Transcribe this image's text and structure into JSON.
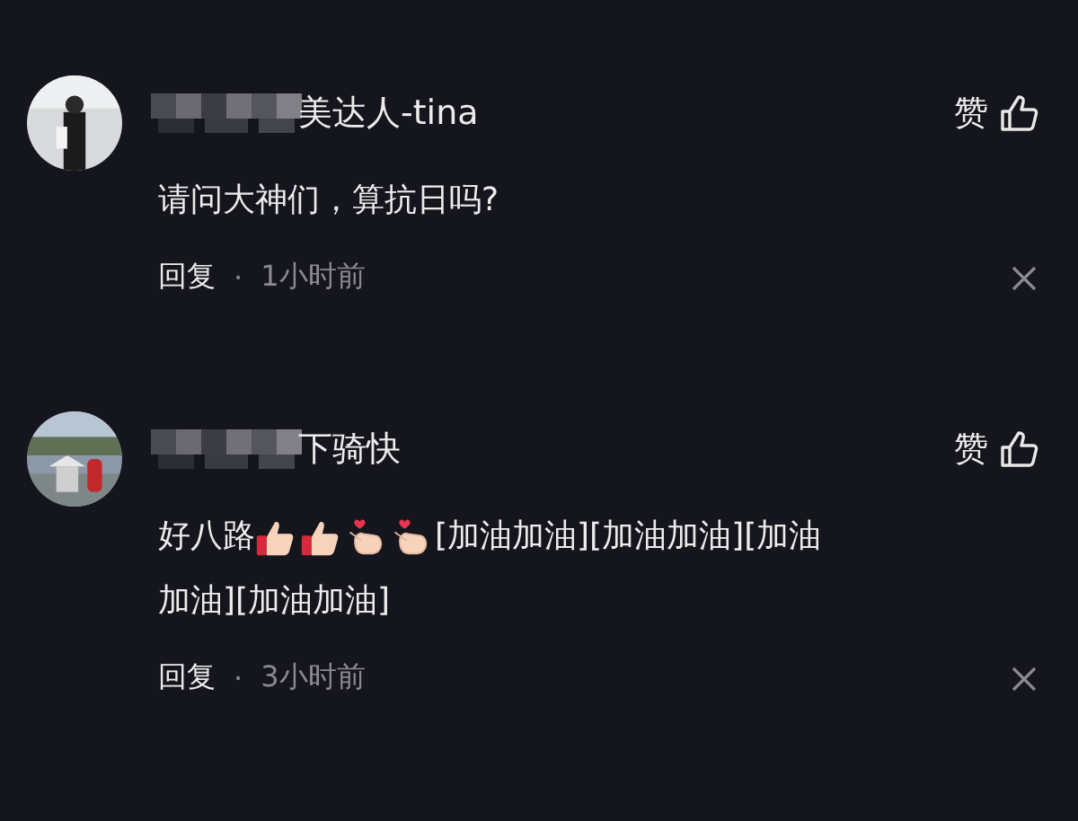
{
  "comments": [
    {
      "avatar": {
        "kind": "picture"
      },
      "username_blurred": true,
      "username": "美达人-tina",
      "like_label": "赞",
      "lines": [
        [
          {
            "kind": "text",
            "text": "请问大神们，算抗日吗?"
          }
        ]
      ],
      "reply_label": "回复",
      "separator": "·",
      "time": "1小时前"
    },
    {
      "avatar": {
        "kind": "picture"
      },
      "username_blurred": true,
      "username": "下骑快",
      "like_label": "赞",
      "lines": [
        [
          {
            "kind": "text",
            "text": "好八路"
          },
          {
            "kind": "thumbs-up"
          },
          {
            "kind": "thumbs-up"
          },
          {
            "kind": "finger-heart"
          },
          {
            "kind": "finger-heart"
          },
          {
            "kind": "text",
            "text": "[加油加油][加油加油][加油"
          }
        ],
        [
          {
            "kind": "text",
            "text": "加油][加油加油]"
          }
        ]
      ],
      "reply_label": "回复",
      "separator": "·",
      "time": "3小时前"
    }
  ]
}
